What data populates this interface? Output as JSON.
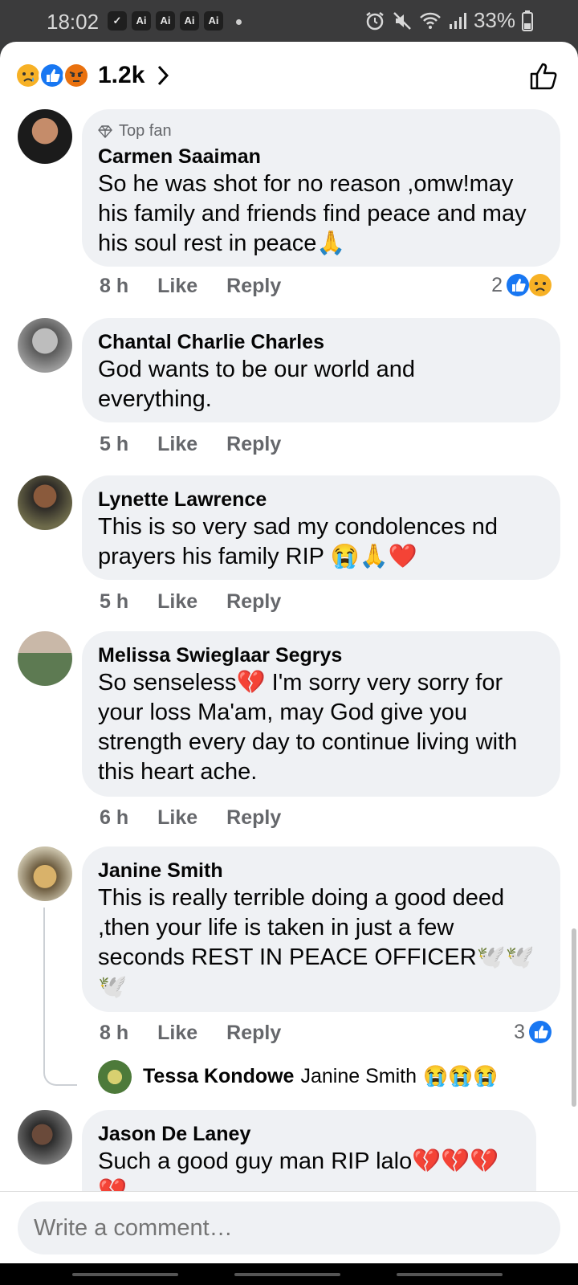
{
  "status_bar": {
    "time": "18:02",
    "app_icons": [
      "✓",
      "Ai",
      "Ai",
      "Ai",
      "Ai"
    ],
    "battery": "33%"
  },
  "reactions": {
    "count": "1.2k"
  },
  "comments": [
    {
      "badge": "Top fan",
      "author": "Carmen Saaiman",
      "text": "So he was shot for no reason ,omw!may his family and friends find peace and may his soul rest in peace🙏",
      "time": "8 h",
      "like": "Like",
      "reply": "Reply",
      "reaction_count": "2"
    },
    {
      "author": "Chantal Charlie Charles",
      "text": "God wants to be our world and everything.",
      "time": "5 h",
      "like": "Like",
      "reply": "Reply"
    },
    {
      "author": "Lynette Lawrence",
      "text": "This is so very sad my condolences nd prayers his family RIP 😭🙏❤️",
      "time": "5 h",
      "like": "Like",
      "reply": "Reply"
    },
    {
      "author": "Melissa Swieglaar Segrys",
      "text": "So senseless💔 I'm sorry very sorry for your loss Ma'am, may God give you strength every day to continue living with this heart ache.",
      "time": "6 h",
      "like": "Like",
      "reply": "Reply"
    },
    {
      "author": "Janine Smith",
      "text": "This is really terrible doing a good deed ,then your life is taken in just a few seconds REST IN PEACE OFFICER🕊️🕊️🕊️",
      "time": "8 h",
      "like": "Like",
      "reply": "Reply",
      "reaction_count": "3"
    },
    {
      "author": "Jason De Laney",
      "text": "Such a good guy man RIP lalo💔💔💔💔"
    }
  ],
  "reply_preview": {
    "author": "Tessa Kondowe",
    "mention": "Janine Smith",
    "emojis": "😭😭😭"
  },
  "input": {
    "placeholder": "Write a comment…"
  },
  "colors": {
    "like_blue": "#1877f2",
    "bubble_bg": "#eff1f4",
    "meta_gray": "#65676b"
  }
}
